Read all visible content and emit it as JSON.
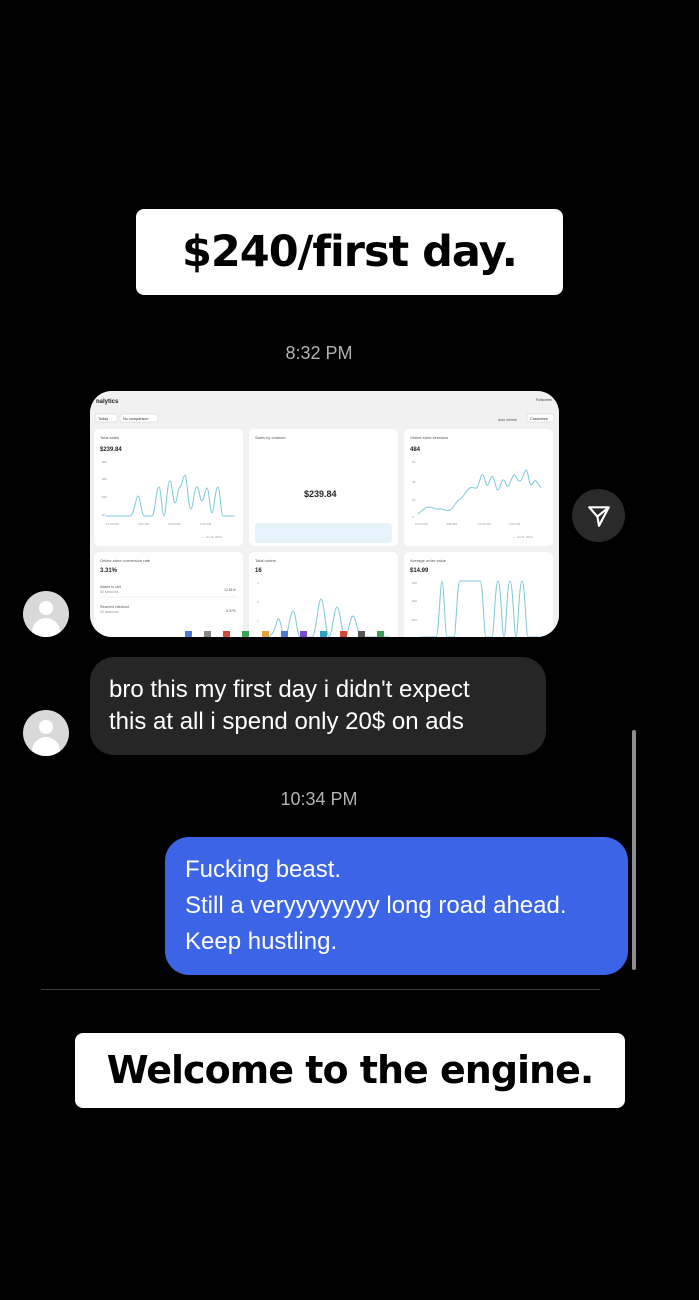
{
  "captions": {
    "top": "$240/first day.",
    "bottom": "Welcome to the engine."
  },
  "timestamps": [
    "8:32 PM",
    "10:34 PM"
  ],
  "screenshot": {
    "title": "nalytics",
    "filters": [
      "Today",
      "No comparison"
    ],
    "right_controls": [
      "Auto refresh",
      "Customize"
    ],
    "fullscreen": "Fullscreen",
    "cards": [
      {
        "title": "Total sales",
        "value": "$239.84",
        "yticks": [
          "$80",
          "$60",
          "$40",
          "$20",
          "$0"
        ],
        "xticks": [
          "12:00 AM",
          "3:00 AM",
          "10:00 AM",
          "3:00 PM"
        ],
        "legend": "— Jun 8, 2024"
      },
      {
        "title": "Sales by channel",
        "value": "$239.84"
      },
      {
        "title": "Online store sessions",
        "value": "484",
        "yticks": [
          "60",
          "40",
          "20",
          "0"
        ],
        "xticks": [
          "12:00 AM",
          "4:00 AM",
          "10:00 AM",
          "3:00 PM"
        ],
        "legend": "— Jun 8, 2024"
      },
      {
        "title": "Online store conversion rate",
        "value": "3.31%",
        "rows": [
          {
            "label": "Added to cart",
            "sub": "62 sessions",
            "value": "12.81%"
          },
          {
            "label": "Reached checkout",
            "sub": "26 sessions",
            "value": "5.37%"
          }
        ]
      },
      {
        "title": "Total orders",
        "value": "16",
        "yticks": [
          "4",
          "2",
          "1"
        ]
      },
      {
        "title": "Average order value",
        "value": "$14.99",
        "yticks": [
          "$30",
          "$20",
          "$10"
        ]
      }
    ]
  },
  "incoming_message": [
    "bro this my first day i didn't expect",
    "this at all i spend only 20$ on ads"
  ],
  "outgoing_message": [
    "Fucking beast.",
    "Still a veryyyyyyyy long road ahead.",
    "Keep hustling."
  ],
  "icons": {
    "avatar": "user-avatar-icon",
    "share": "paper-plane-icon"
  },
  "colors": {
    "background": "#000000",
    "outgoing_bubble": "#3c64e6",
    "incoming_bubble": "#262626",
    "chart_line": "#7fc9d9"
  }
}
